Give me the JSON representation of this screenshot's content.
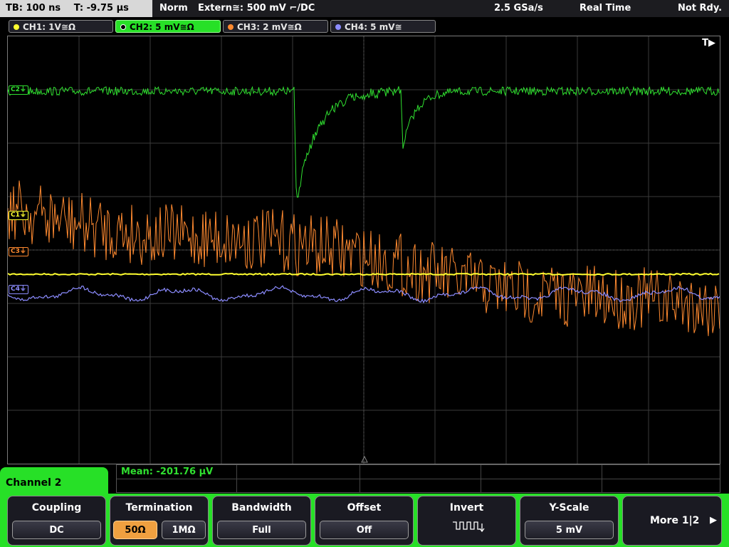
{
  "status": {
    "timebase": "TB: 100 ns",
    "trigger_time": "T: -9.75 µs",
    "mode": "Norm",
    "trigger_source": "Extern≅: 500 mV ⌐/DC",
    "sample_rate": "2.5 GSa/s",
    "acq_mode": "Real Time",
    "ready_state": "Not Rdy."
  },
  "channels": [
    {
      "id": "CH1",
      "label": "CH1: 1V≅Ω",
      "color": "#ffff30",
      "marker": "C1⏚",
      "active": false
    },
    {
      "id": "CH2",
      "label": "CH2: 5 mV≅Ω",
      "color": "#30e030",
      "marker": "C2⏚",
      "active": true
    },
    {
      "id": "CH3",
      "label": "CH3: 2 mV≅Ω",
      "color": "#ff8a30",
      "marker": "C3⏚",
      "active": false
    },
    {
      "id": "CH4",
      "label": "CH4: 5 mV≅",
      "color": "#8c8cff",
      "marker": "C4⏚",
      "active": false
    }
  ],
  "trigger_flag": "T▶",
  "measurement": {
    "mean": "Mean: -201.76 µV"
  },
  "panel": {
    "title": "Channel 2"
  },
  "softkeys": {
    "coupling": {
      "title": "Coupling",
      "value": "DC"
    },
    "termination": {
      "title": "Termination",
      "opt1": "50Ω",
      "opt2": "1MΩ",
      "selected": "50Ω"
    },
    "bandwidth": {
      "title": "Bandwidth",
      "value": "Full"
    },
    "offset": {
      "title": "Offset",
      "value": "Off"
    },
    "invert": {
      "title": "Invert",
      "icon": "square-wave-invert-icon"
    },
    "yscale": {
      "title": "Y-Scale",
      "value": "5 mV"
    },
    "more": {
      "label": "More 1|2",
      "icon": "arrow-right-icon"
    }
  }
}
